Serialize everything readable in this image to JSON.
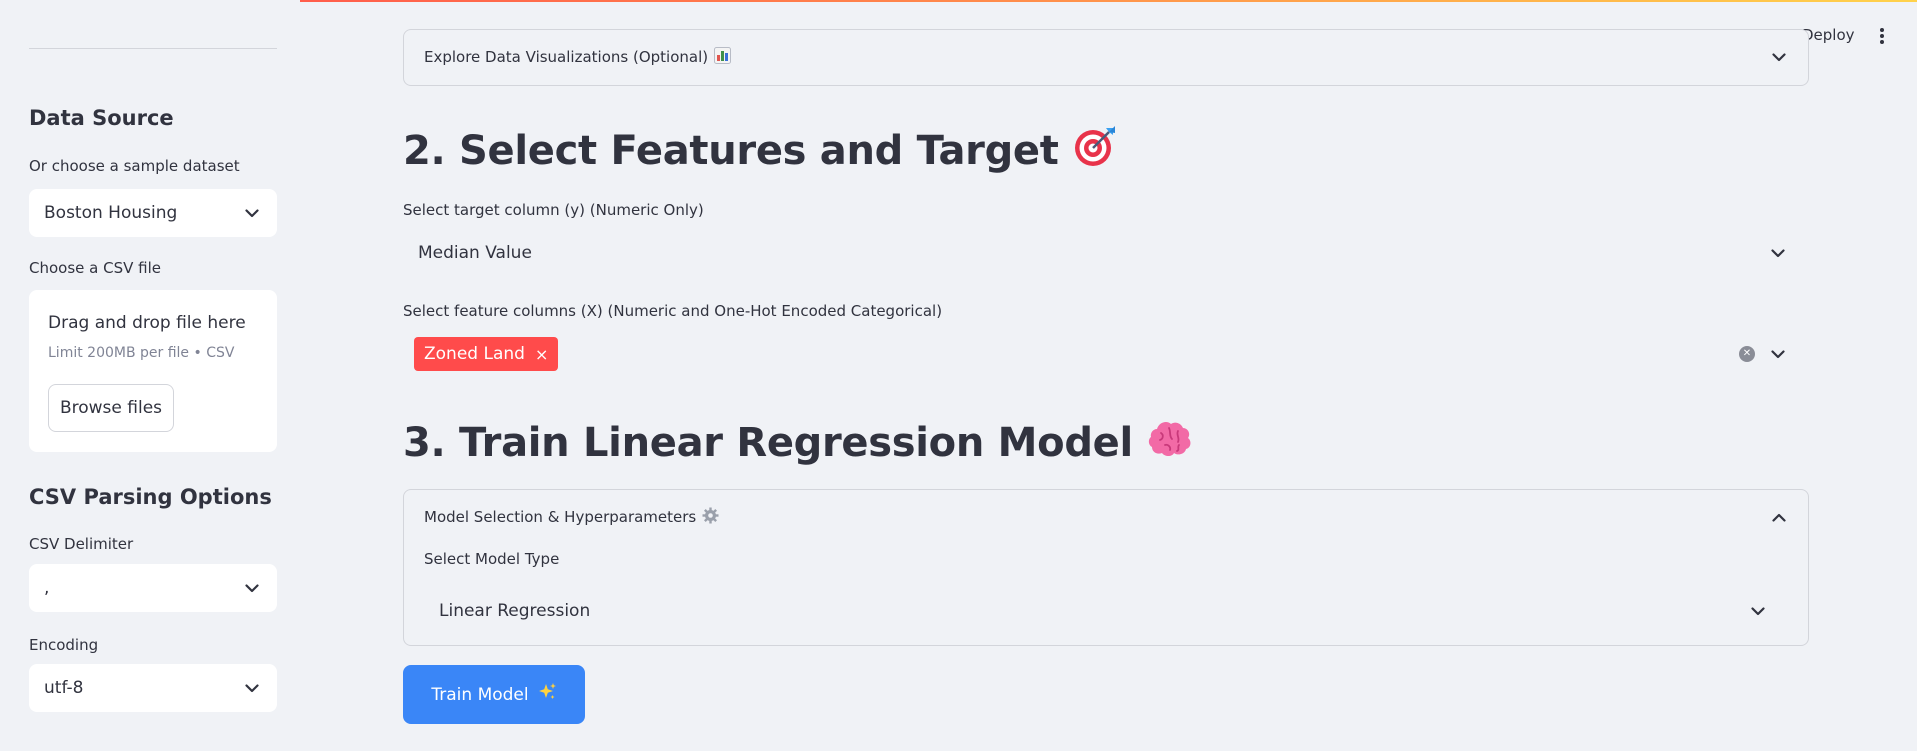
{
  "header": {
    "deploy_label": "Deploy"
  },
  "sidebar": {
    "data_source_heading": "Data Source",
    "sample_label": "Or choose a sample dataset",
    "sample_value": "Boston Housing",
    "csv_file_label": "Choose a CSV file",
    "upload": {
      "drag_text": "Drag and drop file here",
      "limit_text": "Limit 200MB per file • CSV",
      "browse_label": "Browse files"
    },
    "parsing_heading": "CSV Parsing Options",
    "delimiter_label": "CSV Delimiter",
    "delimiter_value": ",",
    "encoding_label": "Encoding",
    "encoding_value": "utf-8"
  },
  "main": {
    "viz_expander_label": "Explore Data Visualizations (Optional)",
    "section2_title": "2. Select Features and Target",
    "target_label": "Select target column (y) (Numeric Only)",
    "target_value": "Median Value",
    "features_label": "Select feature columns (X) (Numeric and One-Hot Encoded Categorical)",
    "features_selected": [
      "Zoned Land"
    ],
    "chip_remove": "×",
    "section3_title": "3. Train Linear Regression Model",
    "model_expander_label": "Model Selection & Hyperparameters",
    "model_type_label": "Select Model Type",
    "model_type_value": "Linear Regression",
    "train_button_label": "Train Model"
  },
  "colors": {
    "accent_red": "#ff4b4b",
    "primary_blue": "#3a86f7",
    "background": "#f0f2f6"
  },
  "icons": {
    "viz": "bar-chart-icon",
    "target": "dart-target-icon",
    "brain": "brain-icon",
    "gear": "gear-icon",
    "sparkles": "sparkles-icon"
  }
}
